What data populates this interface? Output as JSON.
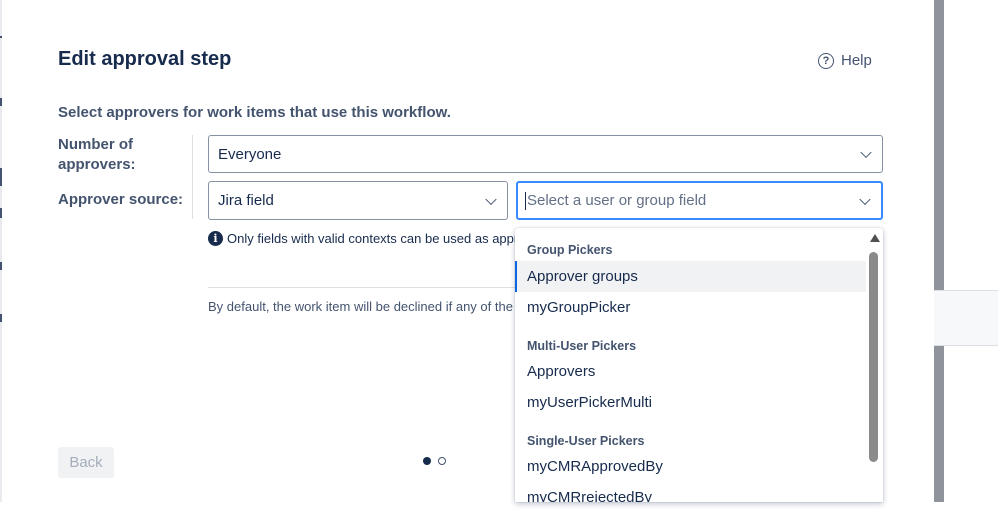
{
  "modal": {
    "title": "Edit approval step",
    "help_label": "Help",
    "help_icon": "question-circle-icon",
    "subtitle": "Select approvers for work items that use this workflow."
  },
  "form": {
    "count_label": "Number of approvers:",
    "count_value": "Everyone",
    "source_label": "Approver source:",
    "source_value": "Jira field",
    "field_placeholder": "Select a user or group field",
    "info_icon": "info-icon",
    "info_text": "Only fields with valid contexts can be used as approv",
    "default_text": "By default, the work item will be declined if any of the se"
  },
  "footer": {
    "back_label": "Back",
    "pager": {
      "current": 1,
      "total": 2
    }
  },
  "dropdown": {
    "groups": [
      {
        "heading": "Group Pickers",
        "options": [
          "Approver groups",
          "myGroupPicker"
        ]
      },
      {
        "heading": "Multi-User Pickers",
        "options": [
          "Approvers",
          "myUserPickerMulti"
        ]
      },
      {
        "heading": "Single-User Pickers",
        "options": [
          "myCMRApprovedBy",
          "myCMRrejectedBy"
        ]
      }
    ],
    "highlighted": "Approver groups"
  },
  "colors": {
    "focus_border": "#388bff",
    "highlight_bar": "#0c66e4",
    "text": "#172b4d",
    "subtle_text": "#44546f"
  }
}
